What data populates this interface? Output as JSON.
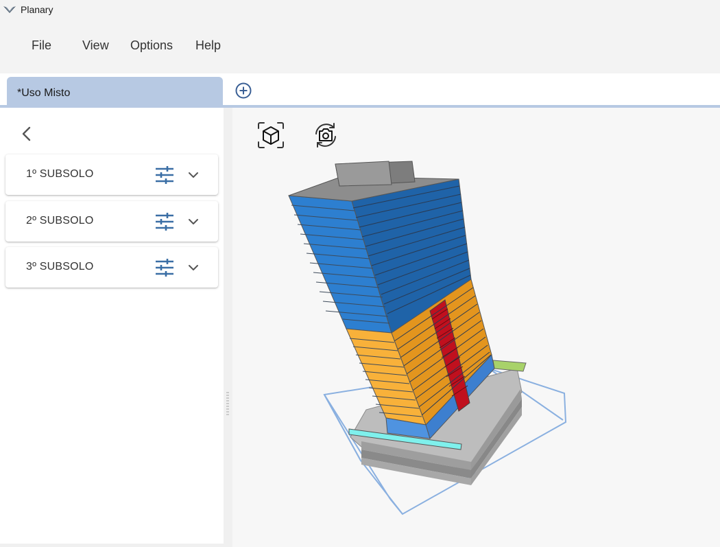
{
  "app": {
    "title": "Planary",
    "logo_icon": "planary-logo-icon"
  },
  "menu": {
    "file": "File",
    "view": "View",
    "options": "Options",
    "help": "Help"
  },
  "tabs": [
    {
      "label": "*Uso Misto",
      "active": true
    }
  ],
  "sidebar": {
    "items": [
      {
        "label": "1º SUBSOLO"
      },
      {
        "label": "2º SUBSOLO"
      },
      {
        "label": "3º SUBSOLO"
      }
    ]
  },
  "viewport": {
    "toolbar_icons": [
      "cube-view-icon",
      "rotate-camera-icon"
    ]
  },
  "colors": {
    "accent": "#b7c9e3",
    "icon_blue": "#3a6ea5",
    "residential_blue": "#1f6fbd",
    "commercial_orange": "#f2a62b",
    "core_red": "#c0101e",
    "ground_light_blue": "#4f93e0",
    "lot_outline": "#8ab0e0",
    "lime": "#a8d26a",
    "cyan": "#7ff0ec"
  }
}
